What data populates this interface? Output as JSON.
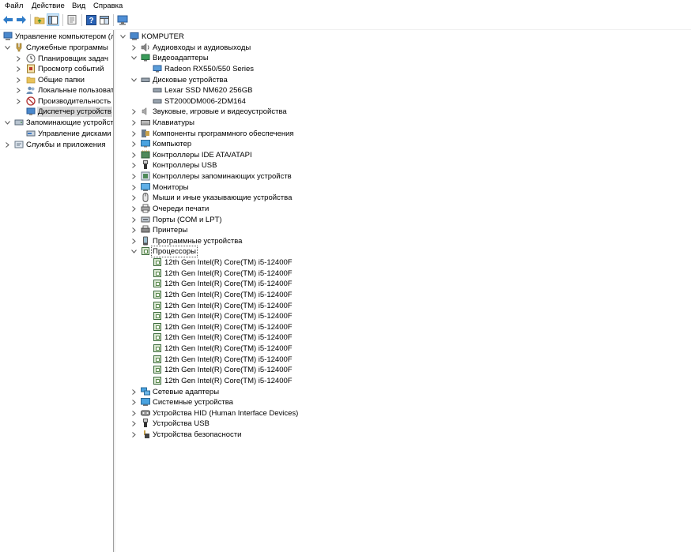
{
  "menu": {
    "file": "Файл",
    "action": "Действие",
    "view": "Вид",
    "help": "Справка"
  },
  "left_tree": {
    "root": "Управление компьютером (л",
    "system_tools": "Служебные программы",
    "task_scheduler": "Планировщик задач",
    "event_viewer": "Просмотр событий",
    "shared_folders": "Общие папки",
    "local_users": "Локальные пользовате",
    "performance": "Производительность",
    "device_manager": "Диспетчер устройств",
    "storage": "Запоминающие устройст",
    "disk_management": "Управление дисками",
    "services_apps": "Службы и приложения"
  },
  "device_tree": {
    "computer_name": "KOMPUTER",
    "categories": {
      "audio_io": "Аудиовходы и аудиовыходы",
      "video_adapters": "Видеоадаптеры",
      "gpu": "Radeon RX550/550 Series",
      "disk_drives": "Дисковые устройства",
      "disk1": "Lexar SSD NM620 256GB",
      "disk2": "ST2000DM006-2DM164",
      "sound": "Звуковые, игровые и видеоустройства",
      "keyboards": "Клавиатуры",
      "software_components": "Компоненты программного обеспечения",
      "computer": "Компьютер",
      "ide": "Контроллеры IDE ATA/ATAPI",
      "usb_controllers": "Контроллеры USB",
      "storage_controllers": "Контроллеры запоминающих устройств",
      "monitors": "Мониторы",
      "mice": "Мыши и иные указывающие устройства",
      "print_queues": "Очереди печати",
      "ports": "Порты (COM и LPT)",
      "printers": "Принтеры",
      "software_devices": "Программные устройства",
      "processors": "Процессоры",
      "network_adapters": "Сетевые адаптеры",
      "system_devices": "Системные устройства",
      "hid": "Устройства HID (Human Interface Devices)",
      "usb_devices": "Устройства USB",
      "security_devices": "Устройства безопасности"
    },
    "processors": [
      "12th Gen Intel(R) Core(TM) i5-12400F",
      "12th Gen Intel(R) Core(TM) i5-12400F",
      "12th Gen Intel(R) Core(TM) i5-12400F",
      "12th Gen Intel(R) Core(TM) i5-12400F",
      "12th Gen Intel(R) Core(TM) i5-12400F",
      "12th Gen Intel(R) Core(TM) i5-12400F",
      "12th Gen Intel(R) Core(TM) i5-12400F",
      "12th Gen Intel(R) Core(TM) i5-12400F",
      "12th Gen Intel(R) Core(TM) i5-12400F",
      "12th Gen Intel(R) Core(TM) i5-12400F",
      "12th Gen Intel(R) Core(TM) i5-12400F",
      "12th Gen Intel(R) Core(TM) i5-12400F"
    ]
  },
  "colors": {
    "selection": "#d9d9d9",
    "toolbar_active": "#cce4f7",
    "chevron": "#555555"
  }
}
